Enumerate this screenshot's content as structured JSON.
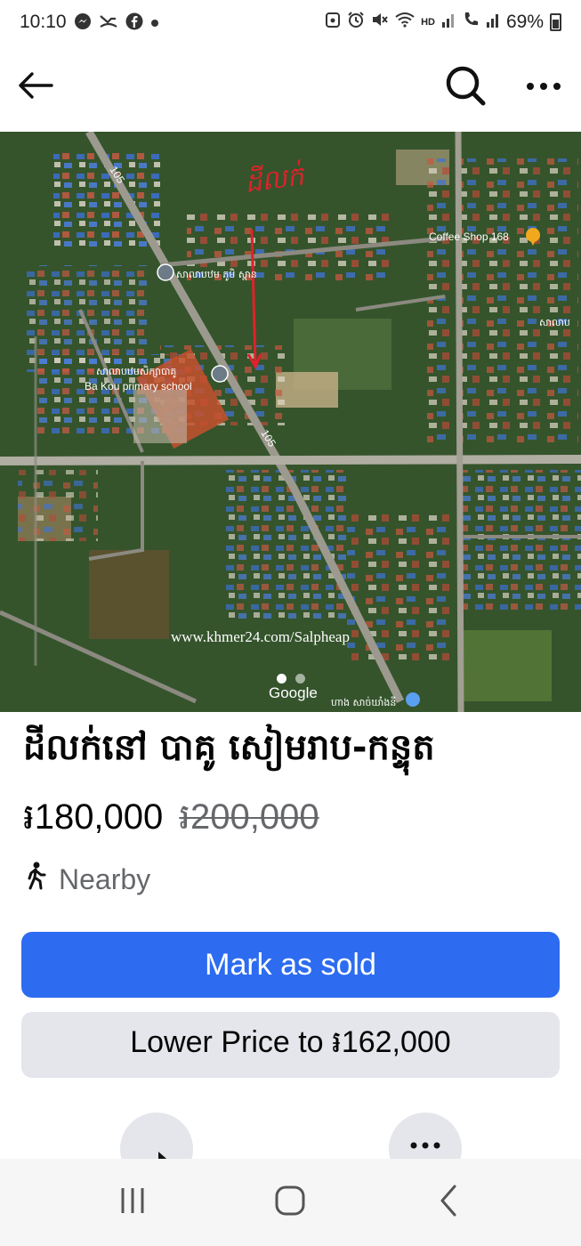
{
  "status_bar": {
    "time": "10:10",
    "left_icons": [
      "messenger-icon",
      "missed-call-icon",
      "facebook-icon",
      "dot-icon"
    ],
    "right_icons": [
      "alarm-icon",
      "mute-icon",
      "wifi-icon",
      "hd-icon",
      "signal-icon",
      "call-icon",
      "signal-2-icon"
    ],
    "hd_label": "HD",
    "battery": "69%"
  },
  "app_bar": {
    "back_icon": "arrow-left-icon",
    "search_icon": "search-icon",
    "more_icon": "more-horizontal-icon"
  },
  "map": {
    "road_label_1": "105",
    "road_label_2": "105",
    "handwritten_label": "ដីលក់",
    "places": [
      {
        "name": "Coffee Shop 168"
      },
      {
        "name": "សាលាបឋម ភូមិ ស្ពាន"
      },
      {
        "name": "សាលាបឋមសិក្សាបាគូ"
      },
      {
        "name": "Ba Kou primary school"
      },
      {
        "name": "ហាង សាច់ឃាំងនី"
      },
      {
        "name": "សាលាប"
      }
    ],
    "watermark": "www.khmer24.com/Salpheap",
    "google_label": "Google",
    "carousel": {
      "count": 2,
      "active_index": 0
    }
  },
  "listing": {
    "title": "ដីលក់នៅ បាគូ សៀមរាប-កន្ទុត",
    "price": "៛180,000",
    "original_price": "៛200,000",
    "nearby_label": "Nearby",
    "nearby_icon": "walking-person-icon"
  },
  "actions": {
    "mark_sold": "Mark as sold",
    "lower_price": "Lower Price to ៛162,000",
    "share_icon": "share-icon",
    "more_icon": "more-horizontal-icon"
  },
  "nav_bar": {
    "recents_icon": "recents-icon",
    "home_icon": "home-icon",
    "back_icon": "back-chevron-icon"
  },
  "colors": {
    "primary_button": "#2d6cf0",
    "secondary_button": "#e4e6eb",
    "secondary_text": "#65676b",
    "annotation_red": "#e0212a"
  }
}
